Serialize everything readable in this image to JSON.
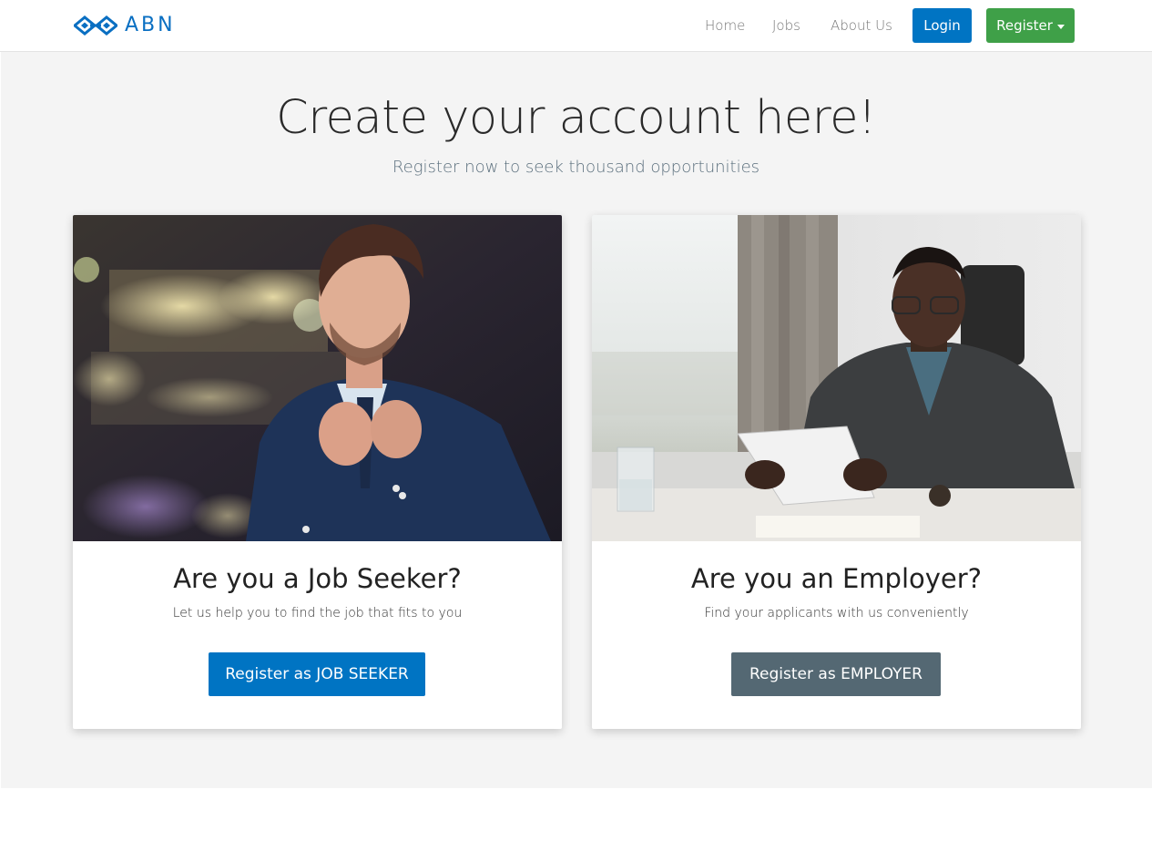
{
  "brand": {
    "name": "ABN"
  },
  "nav": {
    "links": [
      {
        "label": "Home"
      },
      {
        "label": "Jobs"
      },
      {
        "label": "About Us"
      }
    ],
    "login_label": "Login",
    "register_label": "Register"
  },
  "hero": {
    "title": "Create your account here!",
    "subtitle": "Register now to seek thousand opportunities"
  },
  "cards": [
    {
      "title": "Are you a Job Seeker?",
      "text": "Let us help you to find the job that fits to you",
      "button_label": "Register as JOB SEEKER"
    },
    {
      "title": "Are you an Employer?",
      "text": "Find your applicants with us conveniently",
      "button_label": "Register as EMPLOYER"
    }
  ],
  "colors": {
    "primary": "#0074c3",
    "success": "#3fa048",
    "secondary": "#546873",
    "hero_bg": "#f4f4f4"
  }
}
